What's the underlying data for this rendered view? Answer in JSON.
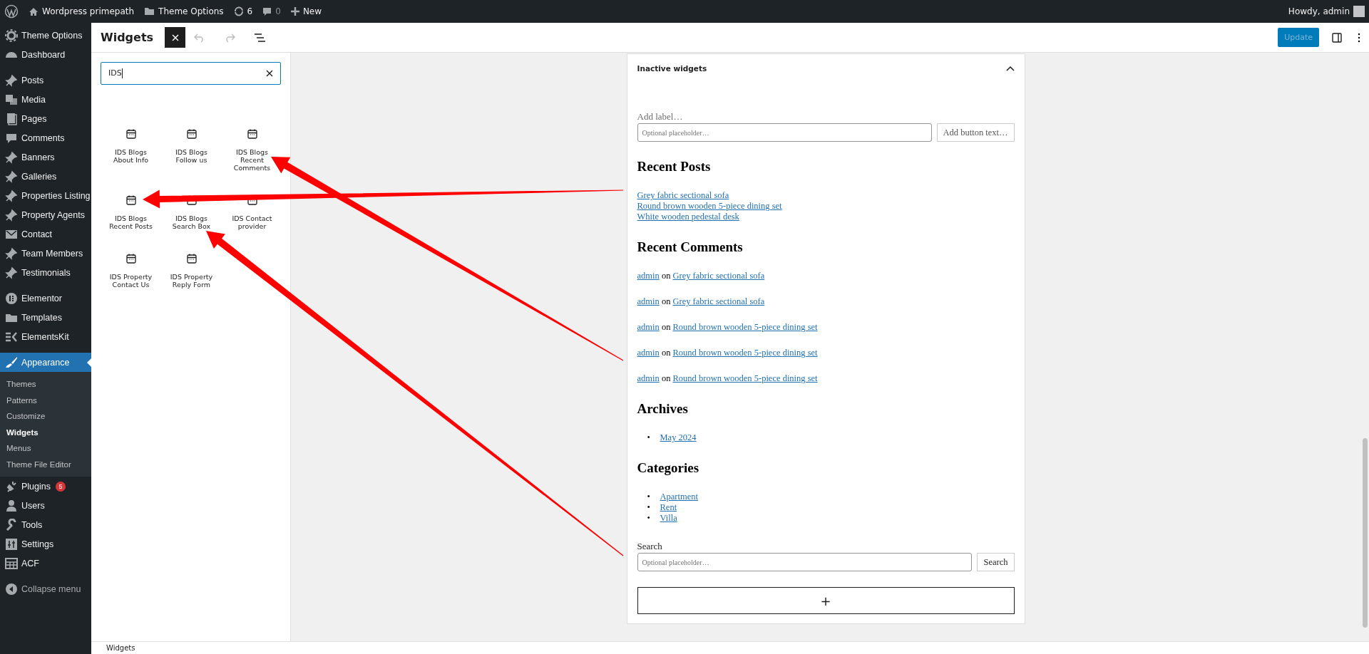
{
  "admin_bar": {
    "site_name": "Wordpress primepath",
    "theme_options": "Theme Options",
    "updates": "6",
    "comments": "0",
    "new": "New",
    "greeting": "Howdy, admin"
  },
  "sidebar": {
    "groups": [
      [
        {
          "label": "Theme Options",
          "selected": false
        },
        {
          "label": "Dashboard",
          "selected": false
        }
      ],
      [
        {
          "label": "Posts",
          "selected": false
        },
        {
          "label": "Media",
          "selected": false
        },
        {
          "label": "Pages",
          "selected": false
        },
        {
          "label": "Comments",
          "selected": false
        },
        {
          "label": "Banners",
          "selected": false
        },
        {
          "label": "Galleries",
          "selected": false
        },
        {
          "label": "Properties Listing",
          "selected": false
        },
        {
          "label": "Property Agents",
          "selected": false
        },
        {
          "label": "Contact",
          "selected": false
        },
        {
          "label": "Team Members",
          "selected": false
        },
        {
          "label": "Testimonials",
          "selected": false
        }
      ],
      [
        {
          "label": "Elementor",
          "selected": false
        },
        {
          "label": "Templates",
          "selected": false
        },
        {
          "label": "ElementsKit",
          "selected": false
        }
      ],
      [
        {
          "label": "Appearance",
          "selected": true,
          "children": [
            {
              "label": "Themes",
              "selected": false
            },
            {
              "label": "Patterns",
              "selected": false
            },
            {
              "label": "Customize",
              "selected": false
            },
            {
              "label": "Widgets",
              "selected": true
            },
            {
              "label": "Menus",
              "selected": false
            },
            {
              "label": "Theme File Editor",
              "selected": false
            }
          ]
        },
        {
          "label": "Plugins",
          "selected": false,
          "badge": "5"
        },
        {
          "label": "Users",
          "selected": false
        },
        {
          "label": "Tools",
          "selected": false
        },
        {
          "label": "Settings",
          "selected": false
        },
        {
          "label": "ACF",
          "selected": false
        }
      ]
    ],
    "collapse": "Collapse menu"
  },
  "editor": {
    "title": "Widgets",
    "update_button": {
      "label": "Update",
      "disabled": true
    }
  },
  "inserter": {
    "search": "IDS",
    "blocks": [
      "IDS Blogs About Info",
      "IDS Blogs Follow us",
      "IDS Blogs Recent Comments",
      "IDS Blogs Recent Posts",
      "IDS Blogs Search Box",
      "IDS Contact provider",
      "IDS Property Contact Us",
      "IDS Property Reply Form"
    ]
  },
  "widget_area": {
    "title": "Inactive widgets",
    "expanded": true,
    "blocks": [
      {
        "kind": "search",
        "label_placeholder": "Add label…",
        "placeholder": "Optional placeholder…",
        "button_placeholder": "Add button text…"
      },
      {
        "kind": "heading",
        "text": "Recent Posts"
      },
      {
        "kind": "links",
        "items": [
          "Grey fabric sectional sofa",
          "Round brown wooden 5-piece dining set",
          "White wooden pedestal desk"
        ]
      },
      {
        "kind": "heading",
        "text": "Recent Comments"
      },
      {
        "kind": "comments",
        "items": [
          {
            "author": "admin",
            "joiner": "on",
            "post": "Grey fabric sectional sofa"
          },
          {
            "author": "admin",
            "joiner": "on",
            "post": "Grey fabric sectional sofa"
          },
          {
            "author": "admin",
            "joiner": "on",
            "post": "Round brown wooden 5-piece dining set"
          },
          {
            "author": "admin",
            "joiner": "on",
            "post": "Round brown wooden 5-piece dining set"
          },
          {
            "author": "admin",
            "joiner": "on",
            "post": "Round brown wooden 5-piece dining set"
          }
        ]
      },
      {
        "kind": "heading",
        "text": "Archives"
      },
      {
        "kind": "bullets",
        "marker": "•",
        "items": [
          "May 2024"
        ]
      },
      {
        "kind": "heading",
        "text": "Categories"
      },
      {
        "kind": "bullets",
        "marker": "•",
        "items": [
          "Apartment",
          "Rent",
          "Villa"
        ]
      },
      {
        "kind": "search",
        "label": "Search",
        "placeholder": "Optional placeholder…",
        "button": "Search"
      },
      {
        "kind": "appender",
        "label": "+"
      }
    ]
  },
  "footer": {
    "breadcrumb": "Widgets"
  }
}
